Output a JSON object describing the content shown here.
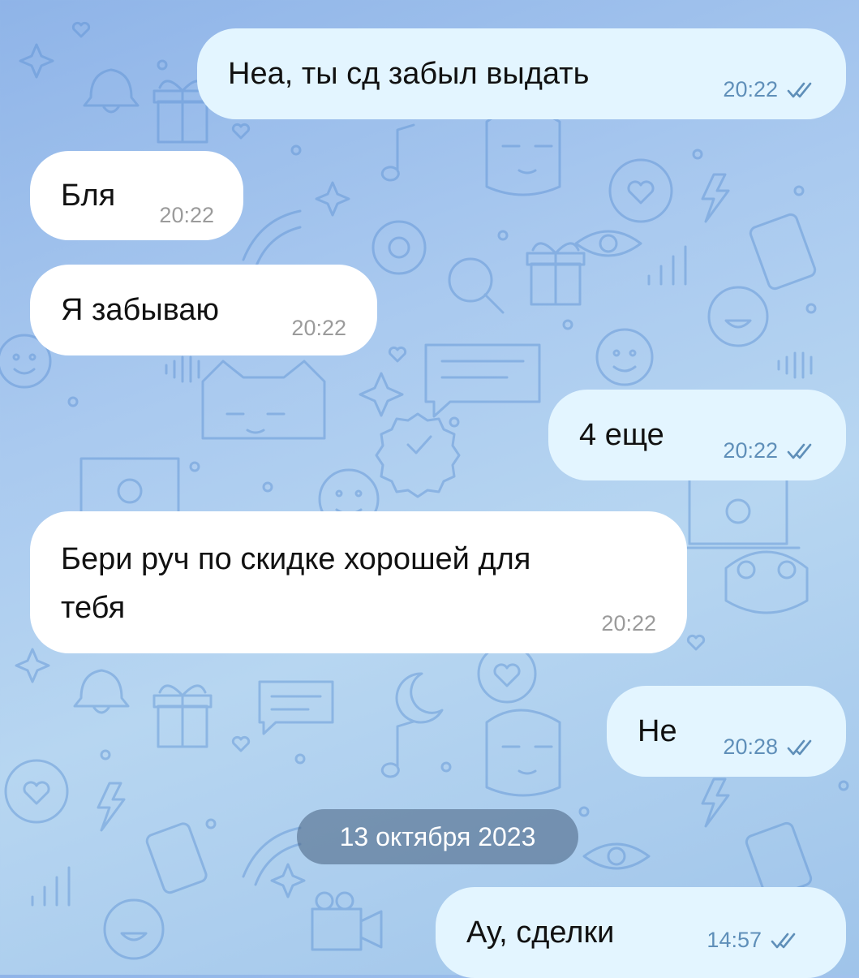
{
  "theme": {
    "outgoing_bubble": "#e3f5ff",
    "incoming_bubble": "#ffffff",
    "outgoing_meta_color": "#5f8fb9",
    "incoming_meta_color": "#9b9b9b",
    "pattern_stroke": "#5b8fd2"
  },
  "messages": [
    {
      "direction": "out",
      "text": "Неа, ты сд забыл выдать",
      "time": "20:22",
      "status": "read",
      "status_icon": "double-check-icon"
    },
    {
      "direction": "in",
      "text": "Бля",
      "time": "20:22"
    },
    {
      "direction": "in",
      "text": "Я забываю",
      "time": "20:22"
    },
    {
      "direction": "out",
      "text": "4 еще",
      "time": "20:22",
      "status": "read",
      "status_icon": "double-check-icon"
    },
    {
      "direction": "in",
      "text_line1": "Бери руч по скидке хорошей для",
      "text_line2": "тебя",
      "time": "20:22"
    },
    {
      "direction": "out",
      "text": "Не",
      "time": "20:28",
      "status": "read",
      "status_icon": "double-check-icon"
    },
    {
      "direction": "out",
      "text": "Ау, сделки",
      "time": "14:57",
      "status": "read",
      "status_icon": "double-check-icon"
    }
  ],
  "date_separator": "13 октября 2023"
}
